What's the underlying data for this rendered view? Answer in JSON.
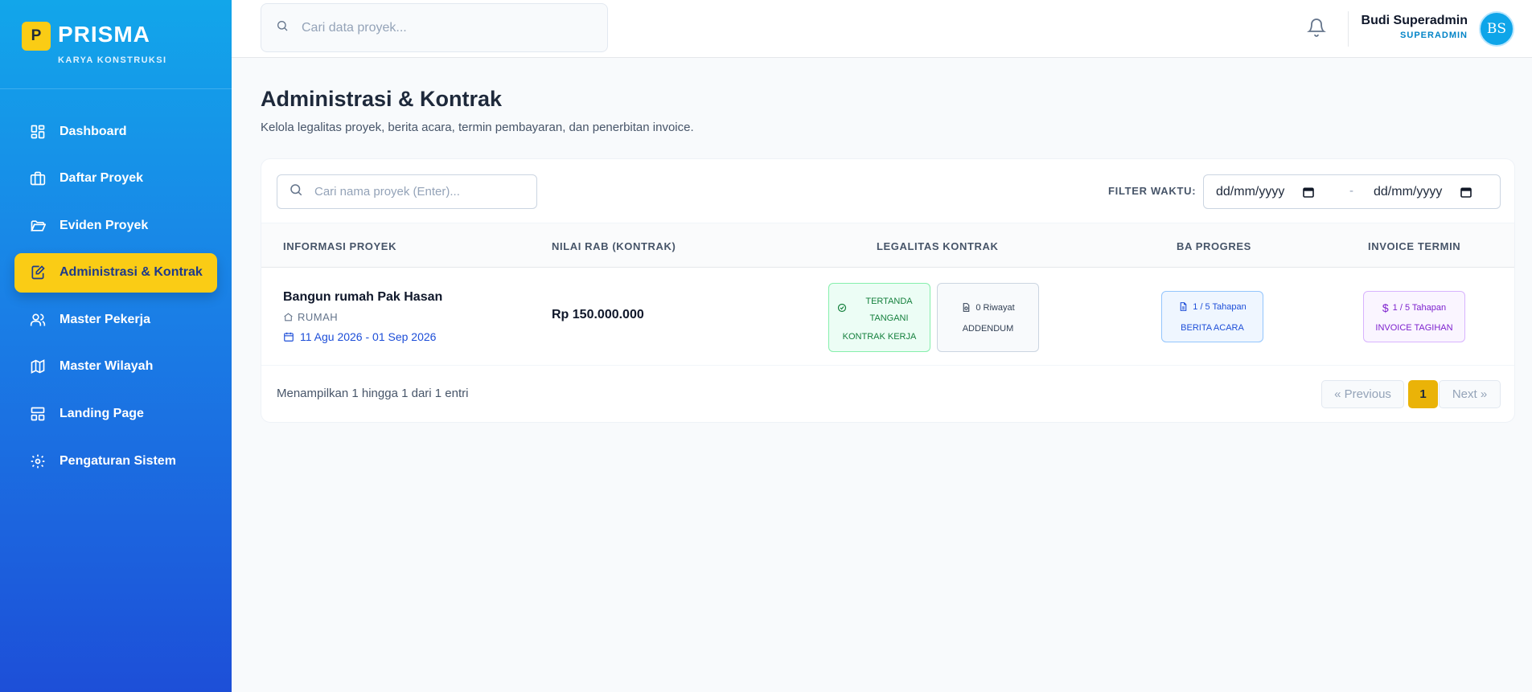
{
  "brand": {
    "logo_letter": "P",
    "name": "PRISMA",
    "subtitle": "KARYA KONSTRUKSI",
    "accent": "#facc15"
  },
  "sidebar": {
    "items": [
      {
        "label": "Dashboard",
        "icon": "dashboard-icon",
        "active": false
      },
      {
        "label": "Daftar Proyek",
        "icon": "briefcase-icon",
        "active": false
      },
      {
        "label": "Eviden Proyek",
        "icon": "folder-open-icon",
        "active": false
      },
      {
        "label": "Administrasi & Kontrak",
        "icon": "file-edit-icon",
        "active": true
      },
      {
        "label": "Master Pekerja",
        "icon": "users-icon",
        "active": false
      },
      {
        "label": "Master Wilayah",
        "icon": "map-icon",
        "active": false
      },
      {
        "label": "Landing Page",
        "icon": "layout-icon",
        "active": false
      },
      {
        "label": "Pengaturan Sistem",
        "icon": "gear-icon",
        "active": false
      }
    ]
  },
  "header": {
    "search_placeholder": "Cari data proyek...",
    "user": {
      "name": "Budi Superadmin",
      "role": "SUPERADMIN",
      "initials": "BS"
    }
  },
  "page": {
    "title": "Administrasi & Kontrak",
    "subtitle": "Kelola legalitas proyek, berita acara, termin pembayaran, dan penerbitan invoice."
  },
  "table": {
    "search_placeholder": "Cari nama proyek (Enter)...",
    "filter_label": "FILTER WAKTU:",
    "date_from": "dd/mm/yyyy",
    "date_separator": "-",
    "date_to": "dd/mm/yyyy",
    "columns": [
      "INFORMASI PROYEK",
      "NILAI RAB (KONTRAK)",
      "LEGALITAS KONTRAK",
      "BA PROGRES",
      "INVOICE TERMIN"
    ],
    "rows": [
      {
        "name": "Bangun rumah Pak Hasan",
        "type": "RUMAH",
        "dates": "11 Agu 2026 - 01 Sep 2026",
        "nilai": "Rp 150.000.000",
        "kontrak_status_line1": "TERTANDA",
        "kontrak_status_line2": "TANGANI",
        "kontrak_label": "KONTRAK KERJA",
        "addendum_count": "0 Riwayat",
        "addendum_label": "ADDENDUM",
        "ba_count": "1 / 5 Tahapan",
        "ba_label": "BERITA ACARA",
        "invoice_count": "1 / 5 Tahapan",
        "invoice_label": "INVOICE TAGIHAN"
      }
    ],
    "footer_info": "Menampilkan 1 hingga 1 dari 1 entri",
    "pagination": {
      "prev": "« Previous",
      "current": "1",
      "next": "Next »"
    }
  }
}
